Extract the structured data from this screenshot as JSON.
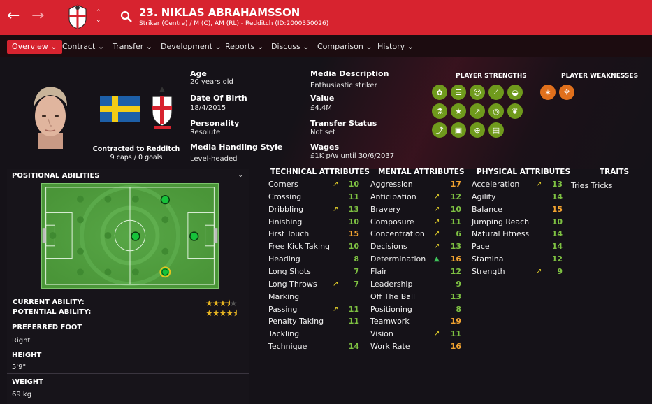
{
  "header": {
    "title": "23. NIKLAS ABRAHAMSSON",
    "subtitle": "Striker (Centre) / M (C), AM (RL) - Redditch (ID:2000350026)",
    "back_icon": "←",
    "forward_icon": "→",
    "updown": "⌃⌄",
    "color_brand": "#d7232f"
  },
  "tabs": [
    "Overview",
    "Contract",
    "Transfer",
    "Development",
    "Reports",
    "Discuss",
    "Comparison",
    "History"
  ],
  "profile": {
    "contracted_to": "Contracted to Redditch",
    "caps_goals": "9 caps / 0 goals",
    "age_label": "Age",
    "age_value": "20 years old",
    "dob_label": "Date Of Birth",
    "dob_value": "18/4/2015",
    "personality_label": "Personality",
    "personality_value": "Resolute",
    "media_style_label": "Media Handling Style",
    "media_style_value": "Level-headed",
    "media_desc_label": "Media Description",
    "media_desc_value": "Enthusiastic striker",
    "value_label": "Value",
    "value_value": "£4.4M",
    "transfer_label": "Transfer Status",
    "transfer_value": "Not set",
    "wages_label": "Wages",
    "wages_value": "£1K p/w until 30/6/2037"
  },
  "strengths": {
    "strengths_label": "PLAYER STRENGTHS",
    "weaknesses_label": "PLAYER WEAKNESSES",
    "strength_icons": [
      "team-icon",
      "notes-icon",
      "head-icon",
      "boot-icon",
      "shoe-icon",
      "flask-icon",
      "star-icon",
      "trend-icon",
      "target-icon",
      "wings-icon",
      "run-icon",
      "pitch-icon",
      "globe-icon",
      "clipboard-icon"
    ],
    "weakness_icons": [
      "kick-icon",
      "trophy-icon"
    ]
  },
  "positional": {
    "title": "POSITIONAL ABILITIES",
    "current_ability_label": "CURRENT ABILITY:",
    "potential_ability_label": "POTENTIAL ABILITY:",
    "current_ability_stars": 3.5,
    "potential_ability_stars": 4.5
  },
  "physical_info": {
    "foot_label": "PREFERRED FOOT",
    "foot_value": "Right",
    "height_label": "HEIGHT",
    "height_value": "5'9\"",
    "weight_label": "WEIGHT",
    "weight_value": "69 kg"
  },
  "technical": {
    "title": "TECHNICAL ATTRIBUTES",
    "items": [
      {
        "name": "Corners",
        "value": "10",
        "arrow": "↗"
      },
      {
        "name": "Crossing",
        "value": "11",
        "arrow": ""
      },
      {
        "name": "Dribbling",
        "value": "13",
        "arrow": "↗"
      },
      {
        "name": "Finishing",
        "value": "10",
        "arrow": ""
      },
      {
        "name": "First Touch",
        "value": "15",
        "arrow": ""
      },
      {
        "name": "Free Kick Taking",
        "value": "10",
        "arrow": ""
      },
      {
        "name": "Heading",
        "value": "8",
        "arrow": ""
      },
      {
        "name": "Long Shots",
        "value": "7",
        "arrow": ""
      },
      {
        "name": "Long Throws",
        "value": "7",
        "arrow": "↗"
      },
      {
        "name": "Marking",
        "value": "",
        "arrow": ""
      },
      {
        "name": "Passing",
        "value": "11",
        "arrow": "↗"
      },
      {
        "name": "Penalty Taking",
        "value": "11",
        "arrow": ""
      },
      {
        "name": "Tackling",
        "value": "",
        "arrow": ""
      },
      {
        "name": "Technique",
        "value": "14",
        "arrow": ""
      }
    ]
  },
  "mental": {
    "title": "MENTAL ATTRIBUTES",
    "items": [
      {
        "name": "Aggression",
        "value": "17",
        "arrow": ""
      },
      {
        "name": "Anticipation",
        "value": "12",
        "arrow": "↗"
      },
      {
        "name": "Bravery",
        "value": "10",
        "arrow": "↗"
      },
      {
        "name": "Composure",
        "value": "11",
        "arrow": "↗"
      },
      {
        "name": "Concentration",
        "value": "6",
        "arrow": "↗"
      },
      {
        "name": "Decisions",
        "value": "13",
        "arrow": "↗"
      },
      {
        "name": "Determination",
        "value": "16",
        "arrow": "▲"
      },
      {
        "name": "Flair",
        "value": "12",
        "arrow": ""
      },
      {
        "name": "Leadership",
        "value": "9",
        "arrow": ""
      },
      {
        "name": "Off The Ball",
        "value": "13",
        "arrow": ""
      },
      {
        "name": "Positioning",
        "value": "8",
        "arrow": ""
      },
      {
        "name": "Teamwork",
        "value": "19",
        "arrow": ""
      },
      {
        "name": "Vision",
        "value": "11",
        "arrow": "↗"
      },
      {
        "name": "Work Rate",
        "value": "16",
        "arrow": ""
      }
    ]
  },
  "physical": {
    "title": "PHYSICAL ATTRIBUTES",
    "items": [
      {
        "name": "Acceleration",
        "value": "13",
        "arrow": "↗"
      },
      {
        "name": "Agility",
        "value": "14",
        "arrow": ""
      },
      {
        "name": "Balance",
        "value": "15",
        "arrow": ""
      },
      {
        "name": "Jumping Reach",
        "value": "10",
        "arrow": ""
      },
      {
        "name": "Natural Fitness",
        "value": "14",
        "arrow": ""
      },
      {
        "name": "Pace",
        "value": "14",
        "arrow": ""
      },
      {
        "name": "Stamina",
        "value": "12",
        "arrow": ""
      },
      {
        "name": "Strength",
        "value": "9",
        "arrow": "↗"
      }
    ]
  },
  "traits": {
    "title": "TRAITS",
    "items": [
      "Tries Tricks"
    ]
  }
}
